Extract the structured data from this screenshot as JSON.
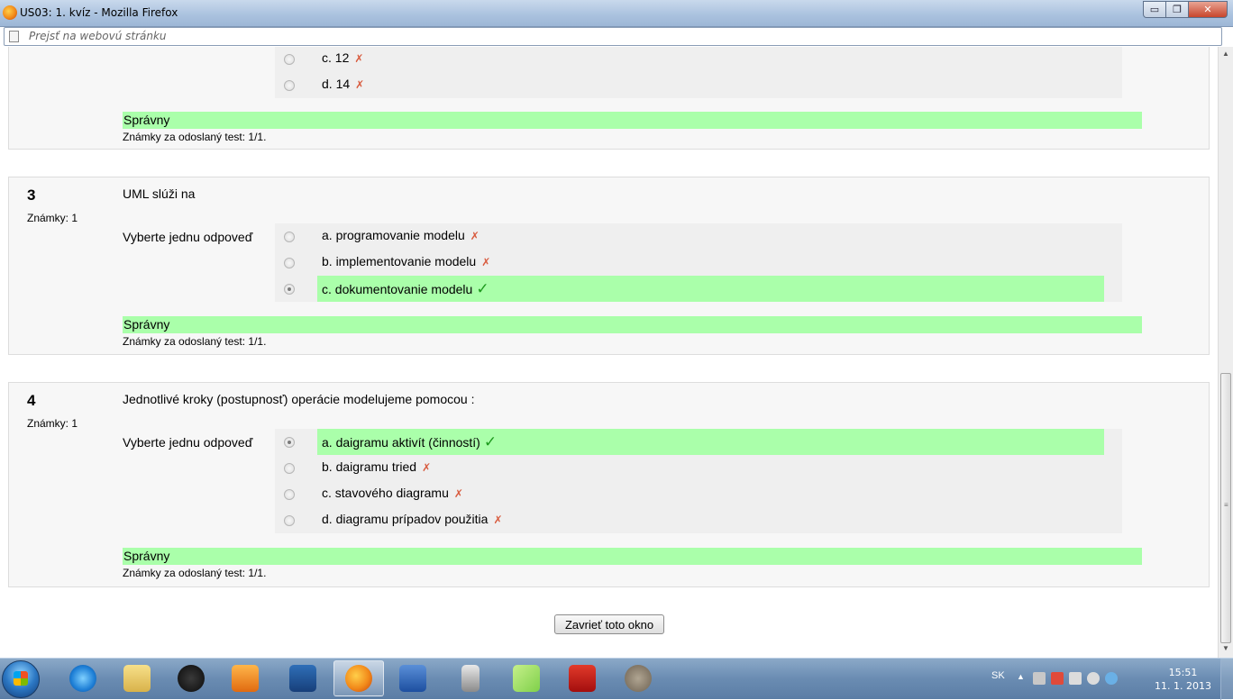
{
  "window": {
    "title": "US03: 1. kvíz - Mozilla Firefox",
    "controls": {
      "minimize": "▭",
      "maximize": "❐",
      "close": "✕"
    }
  },
  "urlbar": {
    "placeholder": "Prejsť na webovú stránku"
  },
  "marks": {
    "wrong": "✗",
    "right": "✓"
  },
  "questions": [
    {
      "number": "",
      "grade": "",
      "text": "",
      "prompt": "",
      "answers": [
        {
          "label": "c. 12",
          "mark": "wrong",
          "checked": false,
          "correct": false
        },
        {
          "label": "d. 14",
          "mark": "wrong",
          "checked": false,
          "correct": false
        }
      ],
      "outcome": "Správny",
      "grade_text": "Známky za odoslaný test: 1/1."
    },
    {
      "number": "3",
      "grade": "Známky: 1",
      "text": "UML slúži na",
      "prompt": "Vyberte jednu odpoveď",
      "answers": [
        {
          "label": "a. programovanie modelu",
          "mark": "wrong",
          "checked": false,
          "correct": false
        },
        {
          "label": "b. implementovanie modelu",
          "mark": "wrong",
          "checked": false,
          "correct": false
        },
        {
          "label": "c. dokumentovanie modelu",
          "mark": "right",
          "checked": true,
          "correct": true
        }
      ],
      "outcome": "Správny",
      "grade_text": "Známky za odoslaný test: 1/1."
    },
    {
      "number": "4",
      "grade": "Známky: 1",
      "text": "Jednotlivé kroky (postupnosť) operácie modelujeme pomocou :",
      "prompt": "Vyberte jednu odpoveď",
      "answers": [
        {
          "label": "a. daigramu aktivít (činností)",
          "mark": "right",
          "checked": true,
          "correct": true
        },
        {
          "label": "b. daigramu tried",
          "mark": "wrong",
          "checked": false,
          "correct": false
        },
        {
          "label": "c. stavového diagramu",
          "mark": "wrong",
          "checked": false,
          "correct": false
        },
        {
          "label": "d. diagramu prípadov použitia",
          "mark": "wrong",
          "checked": false,
          "correct": false
        }
      ],
      "outcome": "Správny",
      "grade_text": "Známky za odoslaný test: 1/1."
    }
  ],
  "close_button": "Zavrieť toto okno",
  "taskbar": {
    "apps": [
      "start-menu",
      "internet-explorer",
      "file-explorer",
      "hp",
      "media-player",
      "task-app",
      "firefox",
      "word",
      "usb-tool",
      "notes",
      "adobe-reader",
      "gimp"
    ],
    "active_app": "firefox",
    "language": "SK",
    "time": "15:51",
    "date": "11. 1. 2013"
  },
  "colors": {
    "correct_bg": "#aaffaa",
    "wrong_mark": "#d85a3d",
    "right_mark": "#1d9a1d",
    "question_bg": "#f7f7f7",
    "answer_bg": "#efefef"
  }
}
